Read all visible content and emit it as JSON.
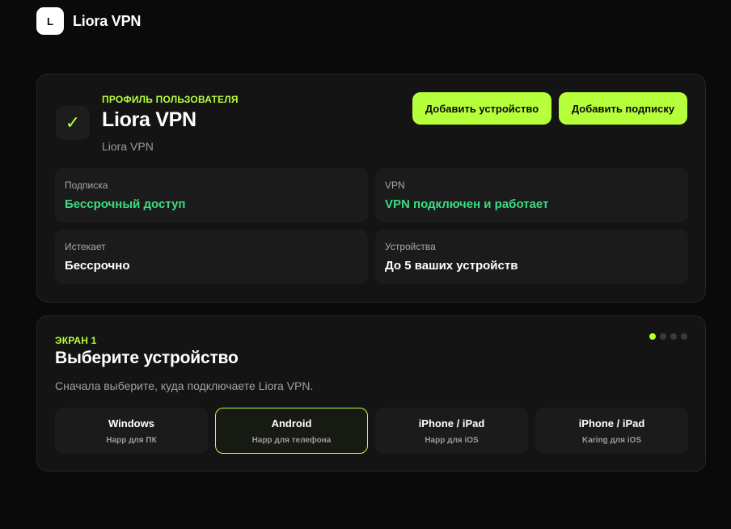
{
  "header": {
    "logo_letter": "L",
    "app_title": "Liora VPN"
  },
  "profile": {
    "eyebrow": "ПРОФИЛЬ ПОЛЬЗОВАТЕЛЯ",
    "check_glyph": "✓",
    "name": "Liora VPN",
    "subtitle": "Liora VPN",
    "buttons": {
      "add_device": "Добавить устройство",
      "add_subscription": "Добавить подписку"
    },
    "tiles": [
      {
        "label": "Подписка",
        "value": "Бессрочный доступ"
      },
      {
        "label": "VPN",
        "value": "VPN подключен и работает"
      },
      {
        "label": "Истекает",
        "value": "Бессрочно"
      },
      {
        "label": "Устройства",
        "value": "До 5 ваших устройств"
      }
    ]
  },
  "screen": {
    "eyebrow": "ЭКРАН 1",
    "title": "Выберите устройство",
    "subtitle": "Сначала выберите, куда подключаете Liora VPN.",
    "step_current": 1,
    "step_total": 4,
    "devices": [
      {
        "name": "Windows",
        "sub": "Happ для ПК"
      },
      {
        "name": "Android",
        "sub": "Happ для телефона",
        "selected": true
      },
      {
        "name": "iPhone / iPad",
        "sub": "Happ для iOS"
      },
      {
        "name": "iPhone / iPad",
        "sub": "Karing для iOS"
      }
    ]
  },
  "colors": {
    "accent": "#b6ff3b",
    "status_green": "#3ddc84",
    "background": "#0a0a0a",
    "card": "#141414"
  }
}
